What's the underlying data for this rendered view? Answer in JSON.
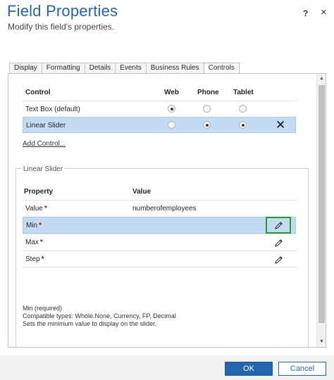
{
  "header": {
    "title": "Field Properties",
    "subtitle": "Modify this field's properties.",
    "help_label": "?",
    "close_label": "×"
  },
  "tabs": [
    {
      "label": "Display",
      "active": false
    },
    {
      "label": "Formatting",
      "active": false
    },
    {
      "label": "Details",
      "active": false
    },
    {
      "label": "Events",
      "active": false
    },
    {
      "label": "Business Rules",
      "active": false
    },
    {
      "label": "Controls",
      "active": true
    }
  ],
  "controls_table": {
    "columns": {
      "control": "Control",
      "web": "Web",
      "phone": "Phone",
      "tablet": "Tablet"
    },
    "rows": [
      {
        "name": "Text Box (default)",
        "web": true,
        "phone": false,
        "tablet": false,
        "selected": false
      },
      {
        "name": "Linear Slider",
        "web": false,
        "phone": true,
        "tablet": true,
        "selected": true,
        "remove_label": "✕"
      }
    ],
    "add_control_label": "Add Control..."
  },
  "slider_section": {
    "legend": "Linear Slider",
    "columns": {
      "property": "Property",
      "value": "Value"
    },
    "required_marker": "*",
    "rows": [
      {
        "property": "Value",
        "value": "numberofemployees",
        "selected": false,
        "has_edit": false
      },
      {
        "property": "Min",
        "value": "",
        "selected": true,
        "has_edit": true
      },
      {
        "property": "Max",
        "value": "",
        "selected": false,
        "has_edit": true
      },
      {
        "property": "Step",
        "value": "",
        "selected": false,
        "has_edit": true
      }
    ],
    "help_lines": [
      "Min (required)",
      "Compatible types: Whole.None, Currency, FP, Decimal",
      "Sets the minimum value to display on the slider."
    ]
  },
  "footer": {
    "ok_label": "OK",
    "cancel_label": "Cancel"
  },
  "colors": {
    "accent": "#2266b0",
    "selection": "#c3dcf2",
    "highlight_border": "#1fa02e",
    "required": "#d0021b"
  }
}
